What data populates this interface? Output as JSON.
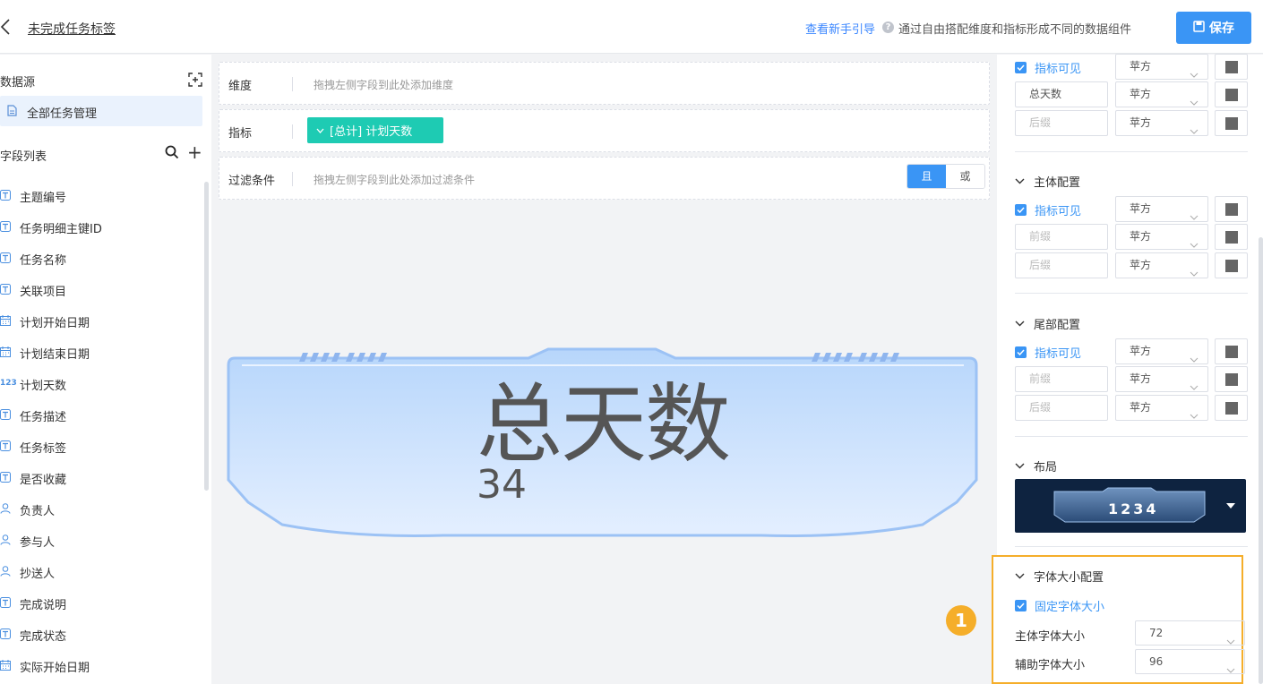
{
  "header": {
    "title": "未完成任务标签",
    "guide_link": "查看新手引导",
    "guide_desc": "通过自由搭配维度和指标形成不同的数据组件",
    "save_label": "保存"
  },
  "left": {
    "datasource_title": "数据源",
    "datasource_item": "全部任务管理",
    "field_list_title": "字段列表",
    "fields": [
      {
        "label": "主题编号",
        "icon": "text-icon"
      },
      {
        "label": "任务明细主键ID",
        "icon": "text-icon"
      },
      {
        "label": "任务名称",
        "icon": "text-icon"
      },
      {
        "label": "关联项目",
        "icon": "text-icon"
      },
      {
        "label": "计划开始日期",
        "icon": "calendar-icon"
      },
      {
        "label": "计划结束日期",
        "icon": "calendar-icon"
      },
      {
        "label": "计划天数",
        "icon": "number-icon"
      },
      {
        "label": "任务描述",
        "icon": "text-icon"
      },
      {
        "label": "任务标签",
        "icon": "text-icon"
      },
      {
        "label": "是否收藏",
        "icon": "text-icon"
      },
      {
        "label": "负责人",
        "icon": "user-icon"
      },
      {
        "label": "参与人",
        "icon": "user-icon"
      },
      {
        "label": "抄送人",
        "icon": "user-icon"
      },
      {
        "label": "完成说明",
        "icon": "text-icon"
      },
      {
        "label": "完成状态",
        "icon": "text-icon"
      },
      {
        "label": "实际开始日期",
        "icon": "calendar-icon"
      }
    ]
  },
  "center": {
    "dimension_label": "维度",
    "dimension_placeholder": "拖拽左侧字段到此处添加维度",
    "metric_label": "指标",
    "metric_chip": "[总计] 计划天数",
    "filter_label": "过滤条件",
    "filter_placeholder": "拖拽左侧字段到此处添加过滤条件",
    "filter_and": "且",
    "filter_or": "或",
    "preview_title": "总天数",
    "preview_value": "34",
    "step_badge": "1"
  },
  "right": {
    "top_section": {
      "visible_label": "指标可见",
      "font_1": "苹方",
      "input_2_value": "总天数",
      "font_2": "苹方",
      "input_3_placeholder": "后缀",
      "font_3": "苹方"
    },
    "body_section": {
      "title": "主体配置",
      "visible_label": "指标可见",
      "font_1": "苹方",
      "prefix_placeholder": "前缀",
      "font_2": "苹方",
      "suffix_placeholder": "后缀",
      "font_3": "苹方"
    },
    "tail_section": {
      "title": "尾部配置",
      "visible_label": "指标可见",
      "font_1": "苹方",
      "prefix_placeholder": "前缀",
      "font_2": "苹方",
      "suffix_placeholder": "后缀",
      "font_3": "苹方"
    },
    "layout_section": {
      "title": "布局",
      "preview_number": "1234"
    },
    "font_size_section": {
      "title": "字体大小配置",
      "fixed_label": "固定字体大小",
      "main_label": "主体字体大小",
      "main_value": "72",
      "aux_label": "辅助字体大小",
      "aux_value": "96"
    }
  },
  "colors": {
    "primary": "#3a95f5",
    "metric_chip": "#1ecbb3",
    "highlight": "#f5ae2a",
    "layout_bg": "#0e2340"
  }
}
